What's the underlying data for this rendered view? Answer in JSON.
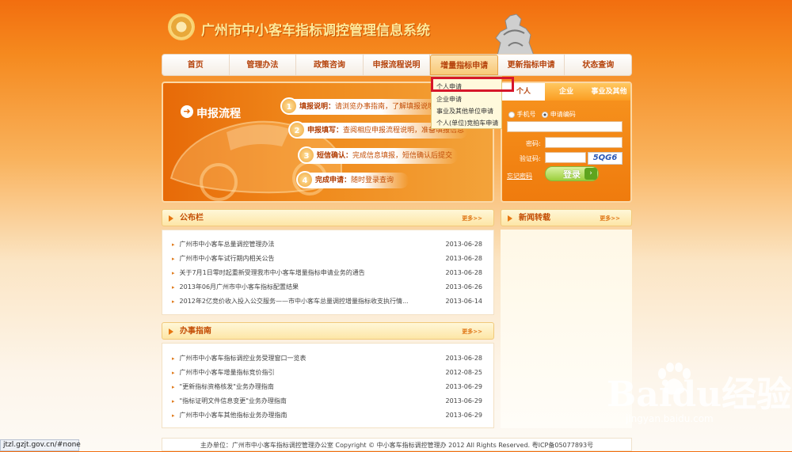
{
  "header": {
    "site_title": "广州市中小客车指标调控管理信息系统"
  },
  "nav": {
    "items": [
      "首页",
      "管理办法",
      "政策咨询",
      "申报流程说明",
      "增量指标申请",
      "更新指标申请",
      "状态查询"
    ],
    "active_index": 4
  },
  "dropdown": {
    "items": [
      "个人申请",
      "企业申请",
      "事业及其他单位申请",
      "个人(单位)竞拍车申请"
    ],
    "highlighted_index": 0
  },
  "banner": {
    "title": "申报流程",
    "steps": [
      {
        "num": "1",
        "name": "填报说明：",
        "desc": "请浏览办事指南，了解填报说明"
      },
      {
        "num": "2",
        "name": "申报填写：",
        "desc": "查阅相应申报流程说明，准备填报信息"
      },
      {
        "num": "3",
        "name": "短信确认：",
        "desc": "完成信息填报，短信确认后提交"
      },
      {
        "num": "4",
        "name": "完成申请：",
        "desc": "随时登录查询"
      }
    ]
  },
  "login": {
    "tabs": [
      "个人",
      "企业",
      "事业及其他"
    ],
    "radio_mobile": "手机号",
    "radio_code": "申请编码",
    "password_label": "密码:",
    "captcha_label": "验证码:",
    "captcha_text": "5QG6",
    "forgot": "忘记密码",
    "login_button": "登录"
  },
  "notice": {
    "title": "公布栏",
    "more": "更多>>",
    "items": [
      {
        "text": "广州市中小客车总量调控管理办法",
        "date": "2013-06-28"
      },
      {
        "text": "广州市中小客车试行期内相关公告",
        "date": "2013-06-28"
      },
      {
        "text": "关于7月1日零时起重新受理我市中小客车增量指标申请业务的通告",
        "date": "2013-06-28"
      },
      {
        "text": "2013年06月广州市中小客车指标配置结果",
        "date": "2013-06-26"
      },
      {
        "text": "2012年2亿竞价收入投入公交服务——市中小客车总量调控增量指标收支执行情...",
        "date": "2013-06-14"
      }
    ]
  },
  "guide": {
    "title": "办事指南",
    "more": "更多>>",
    "items": [
      {
        "text": "广州市中小客车指标调控业务受理窗口一览表",
        "date": "2013-06-28"
      },
      {
        "text": "广州市中小客车增量指标竞价指引",
        "date": "2012-08-25"
      },
      {
        "text": "\"更新指标资格核发\"业务办理指南",
        "date": "2013-06-29"
      },
      {
        "text": "\"指标证明文件信息变更\"业务办理指南",
        "date": "2013-06-29"
      },
      {
        "text": "广州市中小客车其他指标业务办理指南",
        "date": "2013-06-29"
      }
    ]
  },
  "news": {
    "title": "新闻转载",
    "more": "更多>>"
  },
  "footer": {
    "text": "主办单位：广州市中小客车指标调控管理办公室  Copyright © 中小客车指标调控管理办  2012  All Rights Reserved.  粤ICP备05077893号"
  },
  "statusbar": {
    "url": "jtzl.gzjt.gov.cn/#none"
  },
  "watermark": {
    "brand": "Baidu经验",
    "url": "jingyan.baidu.com"
  },
  "colors": {
    "accent": "#f26e0f",
    "highlight_box": "#d6162a",
    "link_text": "#c34d05"
  }
}
